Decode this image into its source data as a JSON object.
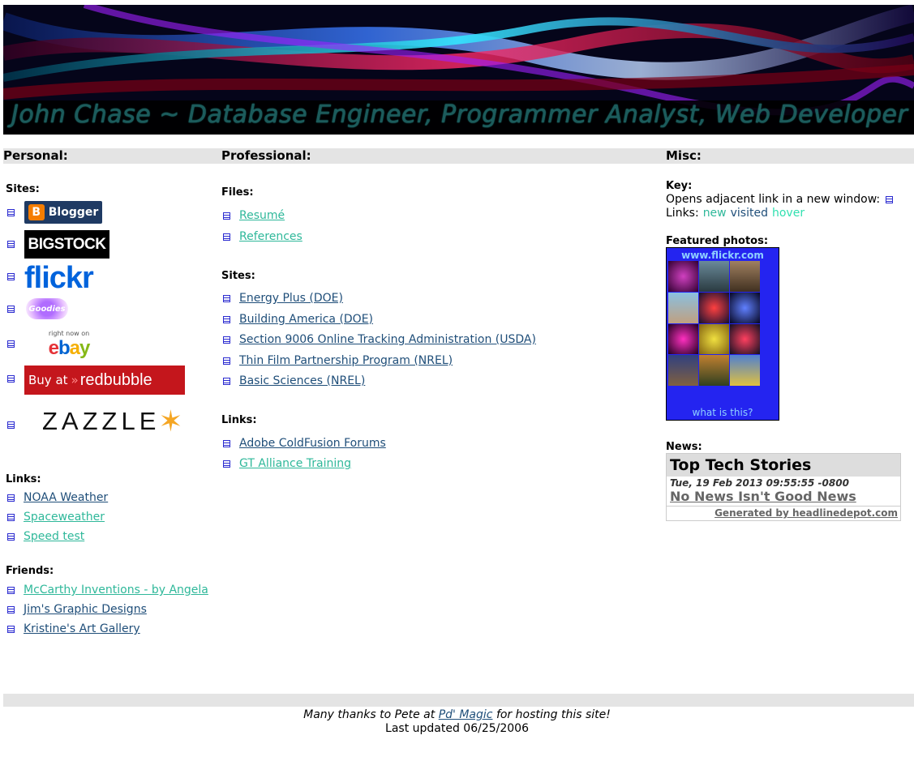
{
  "banner": {
    "title": "John Chase ~ Database Engineer, Programmer Analyst, Web Developer . . ."
  },
  "columns": {
    "personal": "Personal:",
    "professional": "Professional:",
    "misc": "Misc:"
  },
  "personal": {
    "sites_label": "Sites:",
    "logos": {
      "blogger": "Blogger",
      "bigstock": "BIGSTOCK",
      "flickr": "flickr",
      "goodies": "Goodies",
      "ebay_top": "right now on",
      "ebay": "ebay",
      "redbubble_prefix": "Buy at",
      "redbubble": "redbubble",
      "zazzle": "ZAZZLE"
    },
    "links_label": "Links:",
    "links": [
      "NOAA Weather",
      "Spaceweather",
      "Speed test"
    ],
    "friends_label": "Friends:",
    "friends": [
      "McCarthy Inventions - by Angela",
      "Jim's Graphic Designs",
      "Kristine's Art Gallery"
    ]
  },
  "professional": {
    "files_label": "Files:",
    "files": [
      "Resumé",
      "References"
    ],
    "sites_label": "Sites:",
    "sites": [
      "Energy Plus (DOE)",
      "Building America (DOE)",
      "Section 9006 Online Tracking Administration (USDA)",
      "Thin Film Partnership Program (NREL)",
      "Basic Sciences (NREL)"
    ],
    "links_label": "Links:",
    "links": [
      "Adobe ColdFusion Forums",
      "GT Alliance Training"
    ]
  },
  "misc": {
    "key_label": "Key:",
    "key_line": "Opens adjacent link in a new window:",
    "links_prefix": "Links:",
    "links_new": "new",
    "links_visited": "visited",
    "links_hover": "hover",
    "photos_label": "Featured photos:",
    "flickr_url": "www.flickr.com",
    "flickr_footer": "what is this?",
    "news_label": "News:",
    "news": {
      "header": "Top Tech Stories",
      "date": "Tue, 19 Feb 2013 09:55:55 -0800",
      "headline": "No News Isn't Good News",
      "generated": "Generated by headlinedepot.com"
    }
  },
  "footer": {
    "thanks_prefix": "Many thanks to Pete at",
    "thanks_link": "Pd' Magic",
    "thanks_suffix": "for hosting this site!",
    "updated": "Last updated 06/25/2006"
  }
}
